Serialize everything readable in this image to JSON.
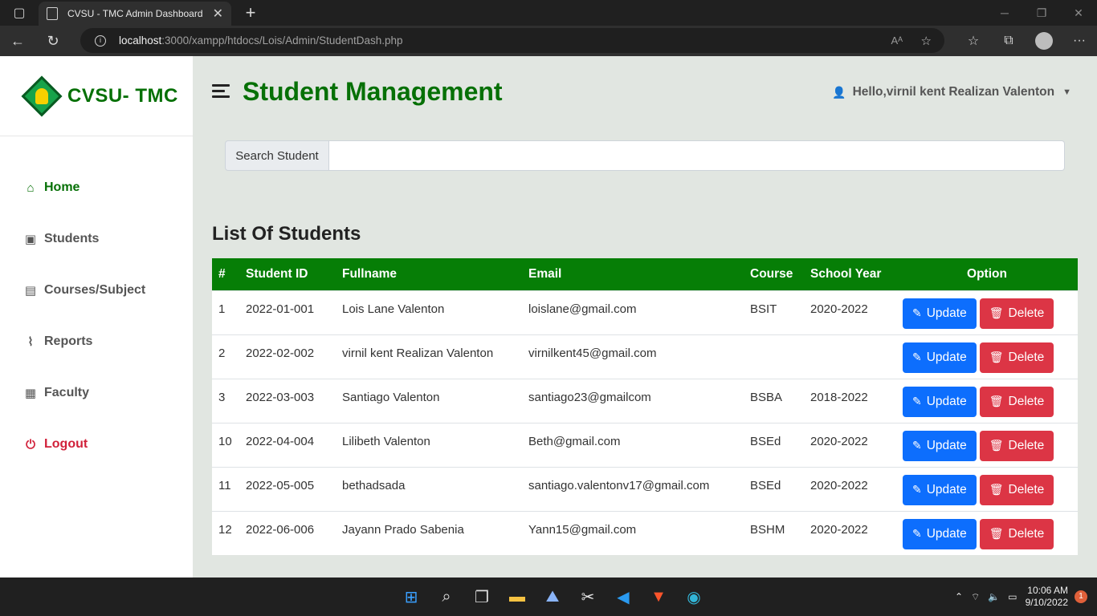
{
  "browser": {
    "tab_title": "CVSU - TMC Admin Dashboard",
    "url_host": "localhost",
    "url_path": ":3000/xampp/htdocs/Lois/Admin/StudentDash.php"
  },
  "sidebar": {
    "brand": "CVSU- TMC",
    "items": [
      {
        "label": "Home",
        "icon": "home-icon"
      },
      {
        "label": "Students",
        "icon": "students-icon"
      },
      {
        "label": "Courses/Subject",
        "icon": "book-icon"
      },
      {
        "label": "Reports",
        "icon": "paperclip-icon"
      },
      {
        "label": "Faculty",
        "icon": "faculty-icon"
      },
      {
        "label": "Logout",
        "icon": "power-icon"
      }
    ]
  },
  "header": {
    "title": "Student Management",
    "user_greeting": "Hello,virnil kent Realizan Valenton"
  },
  "search": {
    "label": "Search Student",
    "value": ""
  },
  "list": {
    "title": "List Of Students",
    "columns": [
      "#",
      "Student ID",
      "Fullname",
      "Email",
      "Course",
      "School Year",
      "Option"
    ],
    "update_label": "Update",
    "delete_label": "Delete",
    "rows": [
      {
        "num": "1",
        "id": "2022-01-001",
        "name": "Lois Lane Valenton",
        "email": "loislane@gmail.com",
        "course": "BSIT",
        "year": "2020-2022"
      },
      {
        "num": "2",
        "id": "2022-02-002",
        "name": "virnil kent Realizan Valenton",
        "email": "virnilkent45@gmail.com",
        "course": "",
        "year": ""
      },
      {
        "num": "3",
        "id": "2022-03-003",
        "name": "Santiago Valenton",
        "email": "santiago23@gmailcom",
        "course": "BSBA",
        "year": "2018-2022"
      },
      {
        "num": "10",
        "id": "2022-04-004",
        "name": "Lilibeth Valenton",
        "email": "Beth@gmail.com",
        "course": "BSEd",
        "year": "2020-2022"
      },
      {
        "num": "11",
        "id": "2022-05-005",
        "name": "bethadsada",
        "email": "santiago.valentonv17@gmail.com",
        "course": "BSEd",
        "year": "2020-2022"
      },
      {
        "num": "12",
        "id": "2022-06-006",
        "name": "Jayann Prado Sabenia",
        "email": "Yann15@gmail.com",
        "course": "BSHM",
        "year": "2020-2022"
      }
    ]
  },
  "taskbar": {
    "time": "10:06 AM",
    "date": "9/10/2022",
    "notifications": "1"
  },
  "colors": {
    "brand_green": "#067006",
    "table_header": "#067e06",
    "update_blue": "#0d6efd",
    "delete_red": "#dc3545"
  }
}
